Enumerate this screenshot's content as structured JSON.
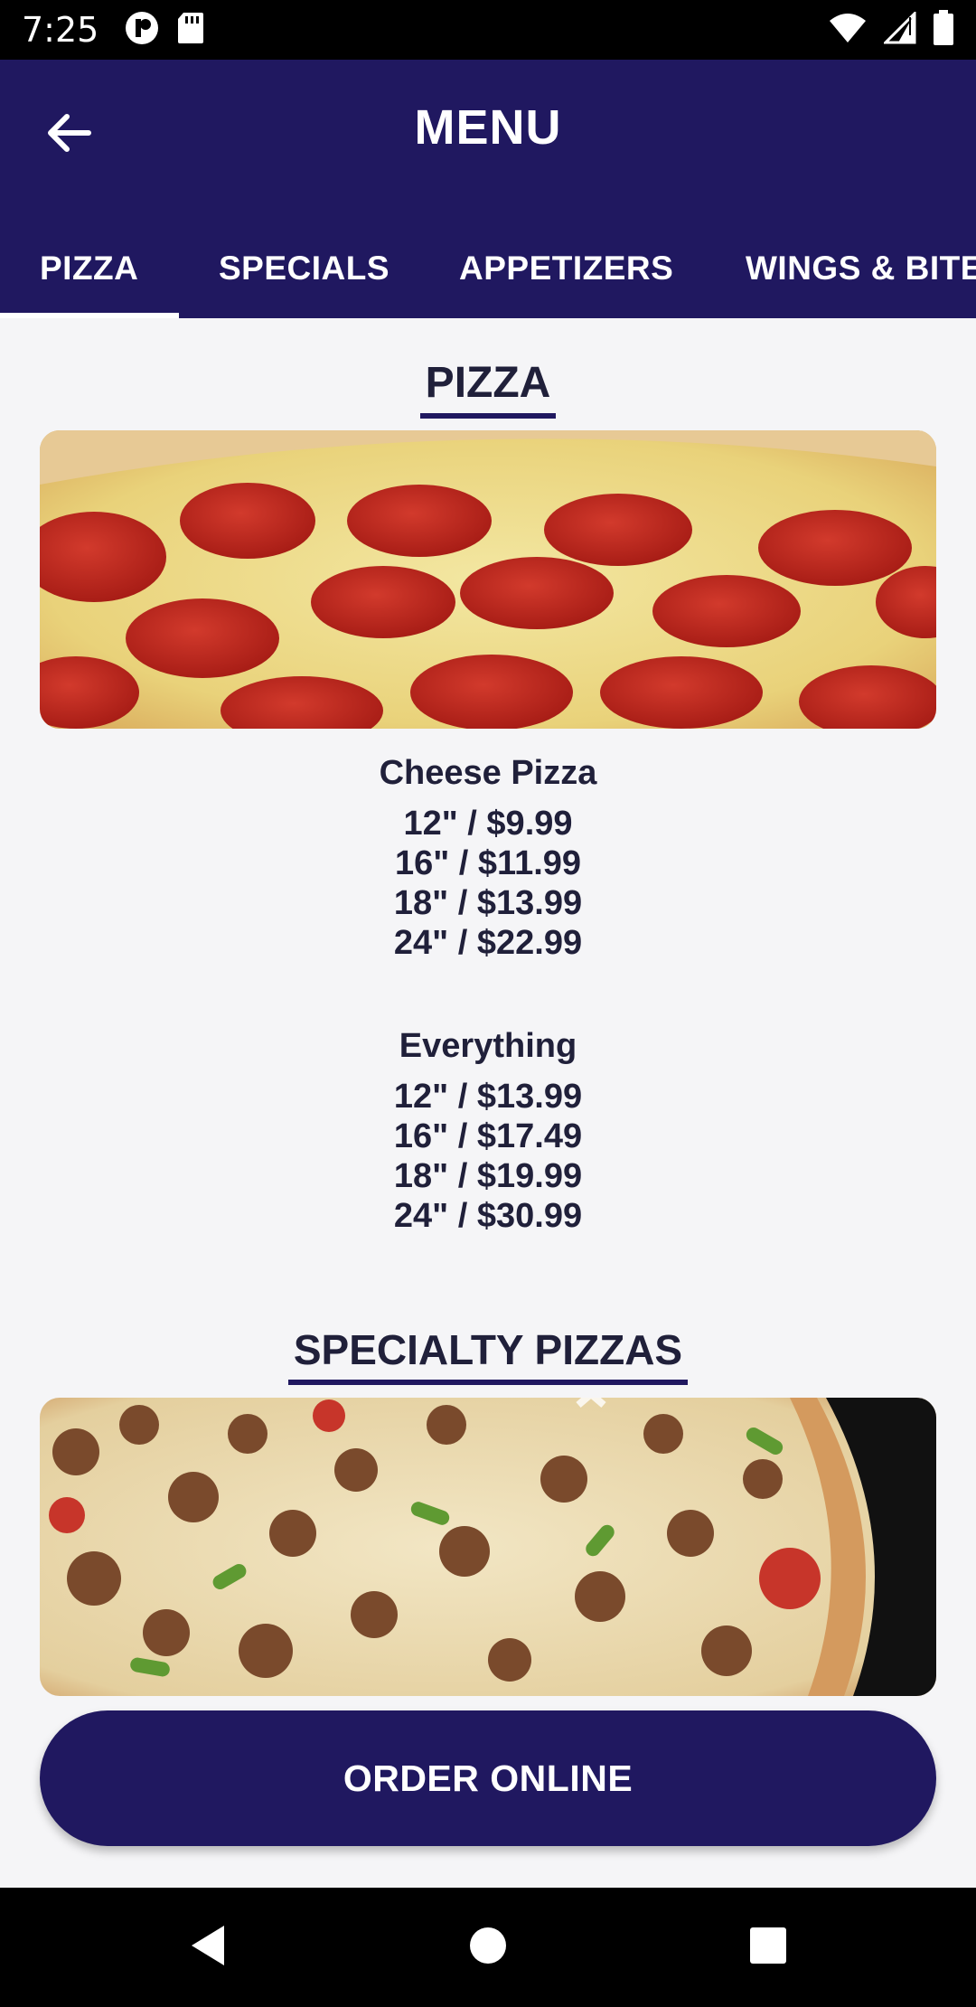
{
  "status_bar": {
    "time": "7:25",
    "icons_left": [
      "record-icon",
      "sd-card-icon"
    ],
    "icons_right": [
      "wifi-icon",
      "signal-icon",
      "battery-icon"
    ]
  },
  "app_bar": {
    "title": "MENU",
    "back_icon": "arrow-left-icon"
  },
  "tabs": [
    {
      "label": "PIZZA",
      "selected": true
    },
    {
      "label": "SPECIALS",
      "selected": false
    },
    {
      "label": "APPETIZERS",
      "selected": false
    },
    {
      "label": "WINGS & BITES",
      "selected": false
    }
  ],
  "sections": [
    {
      "title": "PIZZA",
      "items": [
        {
          "name": "Cheese Pizza",
          "prices": [
            "12\" / $9.99",
            "16\" / $11.99",
            "18\" / $13.99",
            "24\" / $22.99"
          ]
        },
        {
          "name": "Everything",
          "prices": [
            "12\" / $13.99",
            "16\" / $17.49",
            "18\" / $19.99",
            "24\" / $30.99"
          ]
        }
      ]
    },
    {
      "title": "SPECIALTY PIZZAS",
      "items": []
    }
  ],
  "order_button": {
    "label": "ORDER ONLINE"
  },
  "nav_bar": {
    "icons": [
      "back-triangle-icon",
      "home-circle-icon",
      "recents-square-icon"
    ]
  },
  "colors": {
    "primary": "#201860",
    "background": "#f5f5f7",
    "text": "#20203a"
  }
}
